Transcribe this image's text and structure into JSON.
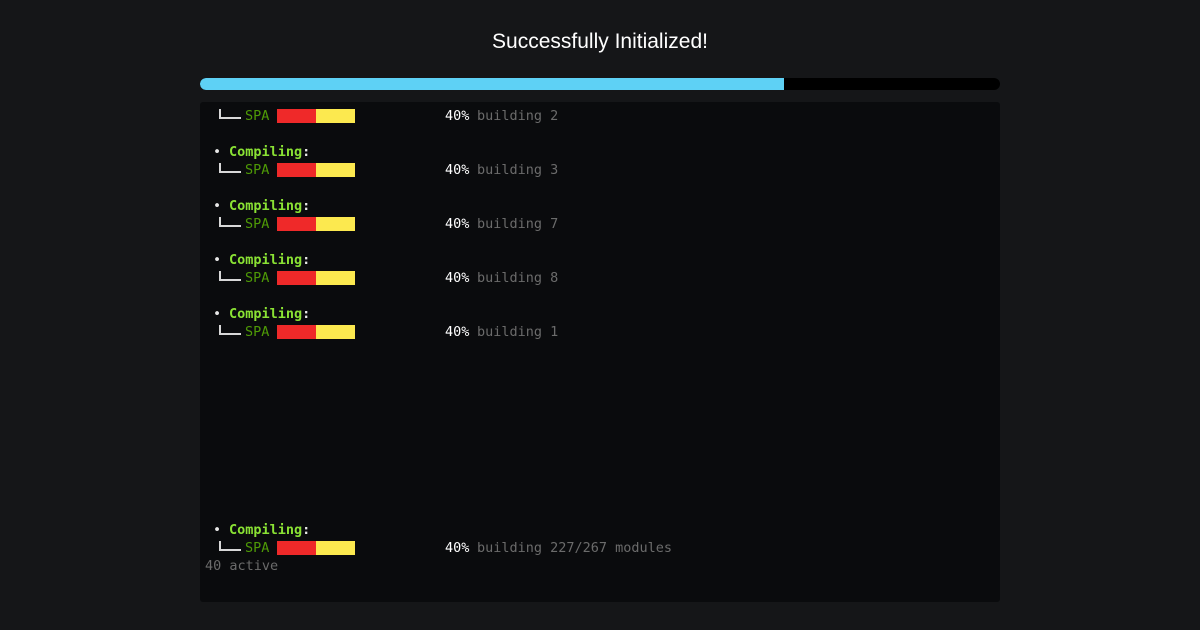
{
  "header": {
    "title": "Successfully Initialized!",
    "progress": 0.73,
    "accent_color": "#5ed1f5"
  },
  "terminal": {
    "compiling_label": "Compiling",
    "colon": ":",
    "bullet": "•",
    "tree_icon": "tree-branch-icon",
    "entries": [
      {
        "show_heading": false,
        "name": "SPA",
        "progress": 0.5,
        "percent": "40%",
        "status": "building 2"
      },
      {
        "show_heading": true,
        "name": "SPA",
        "progress": 0.5,
        "percent": "40%",
        "status": "building 3"
      },
      {
        "show_heading": true,
        "name": "SPA",
        "progress": 0.5,
        "percent": "40%",
        "status": "building 7"
      },
      {
        "show_heading": true,
        "name": "SPA",
        "progress": 0.5,
        "percent": "40%",
        "status": "building 8"
      },
      {
        "show_heading": true,
        "name": "SPA",
        "progress": 0.5,
        "percent": "40%",
        "status": "building 1"
      },
      {
        "show_heading": true,
        "name": "SPA",
        "progress": 0.5,
        "percent": "40%",
        "status": "building 227/267 modules"
      }
    ],
    "active_summary": "40 active",
    "colors": {
      "heading": "#8ae234",
      "name": "#4e9a06",
      "bar_done": "#ef2929",
      "bar_pending": "#fce94f",
      "muted": "#6b6b6b"
    }
  }
}
